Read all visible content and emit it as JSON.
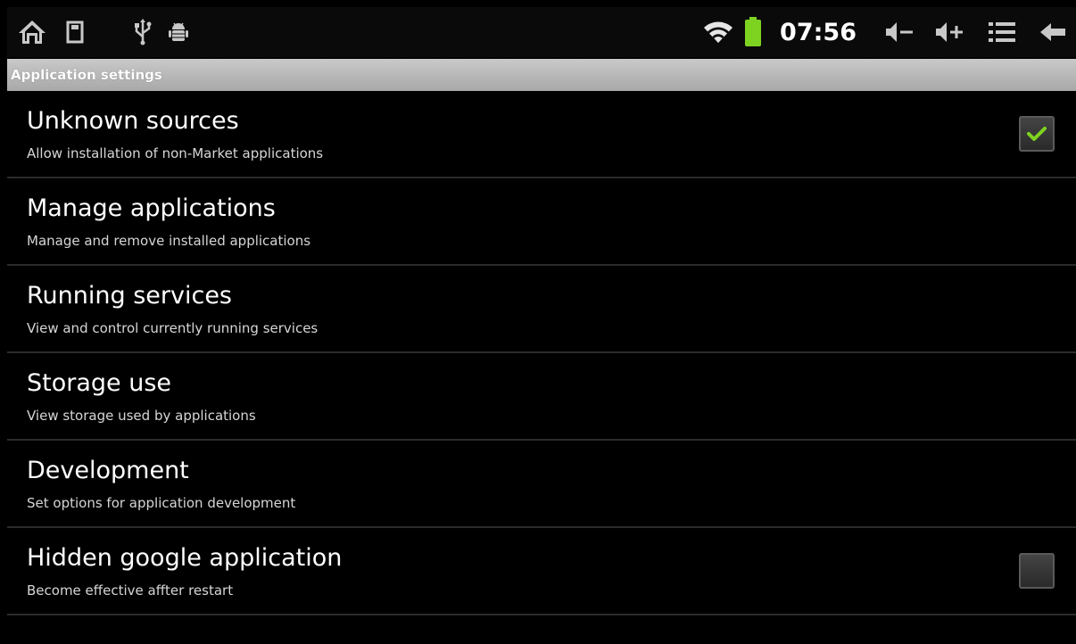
{
  "status_bar": {
    "left_icons": [
      "home-icon",
      "sd-card-icon",
      "usb-icon",
      "android-debug-icon"
    ],
    "right_icons": [
      "wifi-icon",
      "battery-icon",
      "volume-down-icon",
      "volume-up-icon",
      "menu-icon",
      "back-icon"
    ],
    "time": "07:56",
    "battery_color": "#7ed321"
  },
  "header": {
    "title": "Application settings"
  },
  "settings": [
    {
      "title": "Unknown sources",
      "summary": "Allow installation of non-Market applications",
      "has_checkbox": true,
      "checked": true
    },
    {
      "title": "Manage applications",
      "summary": "Manage and remove installed applications",
      "has_checkbox": false
    },
    {
      "title": "Running services",
      "summary": "View and control currently running services",
      "has_checkbox": false
    },
    {
      "title": "Storage use",
      "summary": "View storage used by applications",
      "has_checkbox": false
    },
    {
      "title": "Development",
      "summary": "Set options for application development",
      "has_checkbox": false
    },
    {
      "title": "Hidden google application",
      "summary": "Become effective affter restart",
      "has_checkbox": true,
      "checked": false
    }
  ],
  "colors": {
    "check_mark": "#7ed321",
    "header_bg": "#b8b8b8",
    "background": "#000000"
  }
}
